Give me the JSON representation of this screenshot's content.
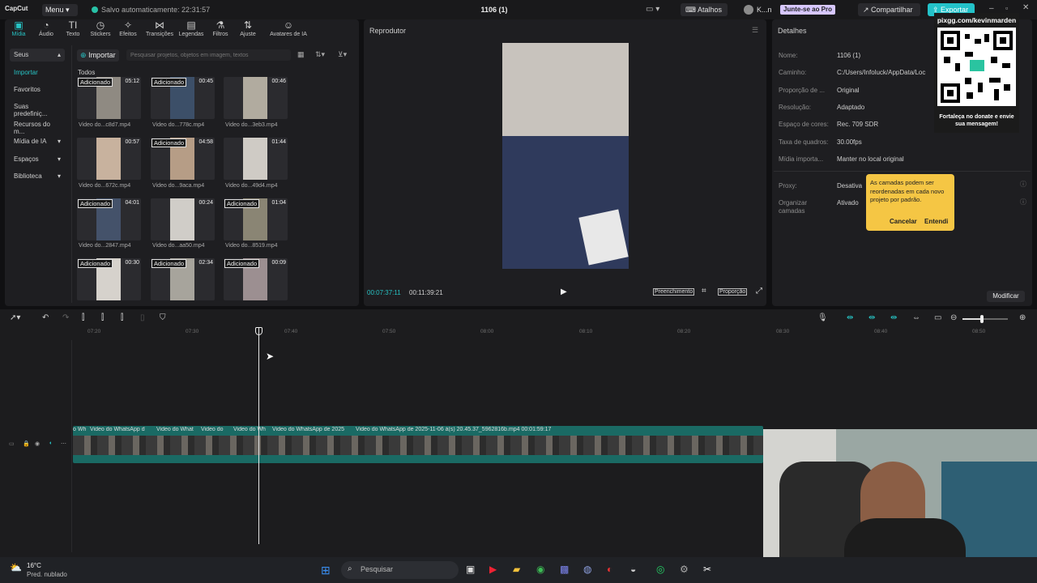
{
  "titlebar": {
    "logo": "CapCut",
    "menu_label": "Menu",
    "saved_text": "Salvo automaticamente: 22:31:57",
    "doc_title": "1106 (1)",
    "shortcuts_label": "Atalhos",
    "user_label": "K...n",
    "pro_label": "Junte-se ao Pro",
    "share_label": "Compartilhar",
    "export_label": "Exportar"
  },
  "toolbar": {
    "tools": [
      {
        "label": "Mídia",
        "icon": "media-icon"
      },
      {
        "label": "Áudio",
        "icon": "audio-icon"
      },
      {
        "label": "Texto",
        "icon": "text-icon"
      },
      {
        "label": "Stickers",
        "icon": "sticker-icon"
      },
      {
        "label": "Efeitos",
        "icon": "effects-icon"
      },
      {
        "label": "Transições",
        "icon": "transition-icon"
      },
      {
        "label": "Legendas",
        "icon": "captions-icon"
      },
      {
        "label": "Filtros",
        "icon": "filter-icon"
      },
      {
        "label": "Ajuste",
        "icon": "adjust-icon"
      },
      {
        "label": "Avatares de IA",
        "icon": "avatar-icon"
      }
    ]
  },
  "sidebar": {
    "items": [
      "Seus",
      "Importar",
      "Favoritos",
      "Suas predefiniç...",
      "Recursos do m...",
      "Mídia de IA",
      "Espaços",
      "Biblioteca"
    ]
  },
  "media": {
    "import_label": "Importar",
    "search_placeholder": "Pesquisar projetos, objetos em imagem, textos",
    "all_label": "Todos",
    "items": [
      {
        "badge": "Adicionado",
        "duration": "05:12",
        "name": "Video do...c8d7.mp4"
      },
      {
        "badge": "Adicionado",
        "duration": "00:45",
        "name": "Video do...778c.mp4"
      },
      {
        "badge": "",
        "duration": "00:46",
        "name": "Video do...3eb3.mp4"
      },
      {
        "badge": "",
        "duration": "00:57",
        "name": "Video do...672c.mp4"
      },
      {
        "badge": "Adicionado",
        "duration": "04:58",
        "name": "Video do...9aca.mp4"
      },
      {
        "badge": "",
        "duration": "01:44",
        "name": "Video do...49d4.mp4"
      },
      {
        "badge": "Adicionado",
        "duration": "04:01",
        "name": "Video do...2847.mp4"
      },
      {
        "badge": "",
        "duration": "00:24",
        "name": "Video do...aa50.mp4"
      },
      {
        "badge": "Adicionado",
        "duration": "01:04",
        "name": "Video do...8519.mp4"
      },
      {
        "badge": "Adicionado",
        "duration": "00:30",
        "name": ""
      },
      {
        "badge": "Adicionado",
        "duration": "02:34",
        "name": ""
      },
      {
        "badge": "Adicionado",
        "duration": "00:09",
        "name": ""
      }
    ]
  },
  "player": {
    "title": "Reprodutor",
    "current_time": "00:07:37:11",
    "total_time": "00:11:39:21",
    "fill_label": "Preenchimento",
    "ratio_label": "Proporção"
  },
  "details": {
    "title": "Detalhes",
    "rows": [
      {
        "label": "Nome:",
        "value": "1106 (1)"
      },
      {
        "label": "Caminho:",
        "value": "C:/Users/Infoluck/AppData/Loc"
      },
      {
        "label": "Proporção de ...",
        "value": "Original"
      },
      {
        "label": "Resolução:",
        "value": "Adaptado"
      },
      {
        "label": "Espaço de cores:",
        "value": "Rec. 709 SDR"
      },
      {
        "label": "Taxa de quadros:",
        "value": "30.00fps"
      },
      {
        "label": "Mídia importa...",
        "value": "Manter no local original"
      },
      {
        "label": "Proxy:",
        "value": "Desativa"
      },
      {
        "label": "Organizar camadas",
        "value": "Ativado"
      }
    ],
    "modify_label": "Modificar"
  },
  "tooltip": {
    "text": "As camadas podem ser reordenadas em cada novo projeto por padrão.",
    "cancel": "Cancelar",
    "ok": "Entendi"
  },
  "overlay": {
    "url": "pixgg.com/kevinmarden",
    "message": "Fortaleça no donate e envie sua mensagem!"
  },
  "timeline": {
    "ruler": [
      "07:20",
      "07:30",
      "07:40",
      "07:50",
      "08:00",
      "08:10",
      "08:20",
      "08:30",
      "08:40",
      "08:50"
    ],
    "clips": [
      "o Wh",
      "Video do WhatsApp d",
      "Video do What",
      "Video do",
      "Video do Wh",
      "Video do WhatsApp de 2025",
      "Video do WhatsApp de 2025-11-06 à(s) 20.45.37_5962816b.mp4   00:01:59:17"
    ]
  },
  "taskbar": {
    "temp": "16°C",
    "weather": "Pred. nublado",
    "search": "Pesquisar"
  }
}
